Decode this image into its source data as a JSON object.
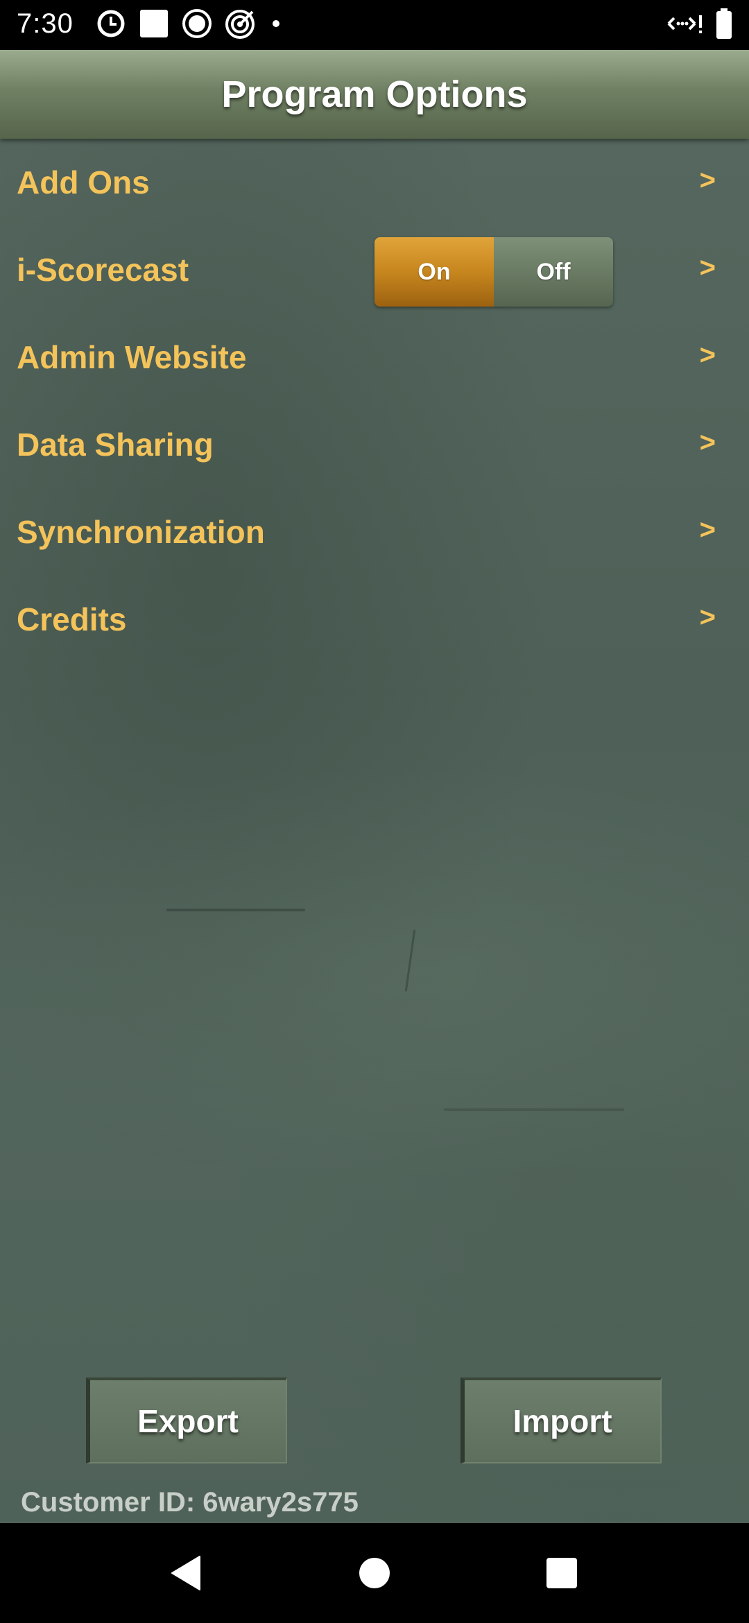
{
  "status_bar": {
    "time": "7:30",
    "left_icons": [
      "alarm-clock-icon",
      "square-notification-icon",
      "circle-notification-icon",
      "target-icon",
      "dot-icon"
    ],
    "right_icons": [
      "data-transfer-icon",
      "battery-icon"
    ]
  },
  "header": {
    "title": "Program Options"
  },
  "options": [
    {
      "label": "Add Ons",
      "chevron": ">"
    },
    {
      "label": "i-Scorecast",
      "chevron": ">"
    },
    {
      "label": "Admin Website",
      "chevron": ">"
    },
    {
      "label": "Data Sharing",
      "chevron": ">"
    },
    {
      "label": "Synchronization",
      "chevron": ">"
    },
    {
      "label": "Credits",
      "chevron": ">"
    }
  ],
  "scorecast_toggle": {
    "on_label": "On",
    "off_label": "Off",
    "selected": "On"
  },
  "buttons": {
    "export": "Export",
    "import": "Import"
  },
  "customer_id": "Customer ID: 6wary2s775",
  "colors": {
    "accent": "#f4c35a",
    "toggle_on": "#c7861e",
    "toggle_off": "#6a7b64",
    "background": "#52655c"
  }
}
